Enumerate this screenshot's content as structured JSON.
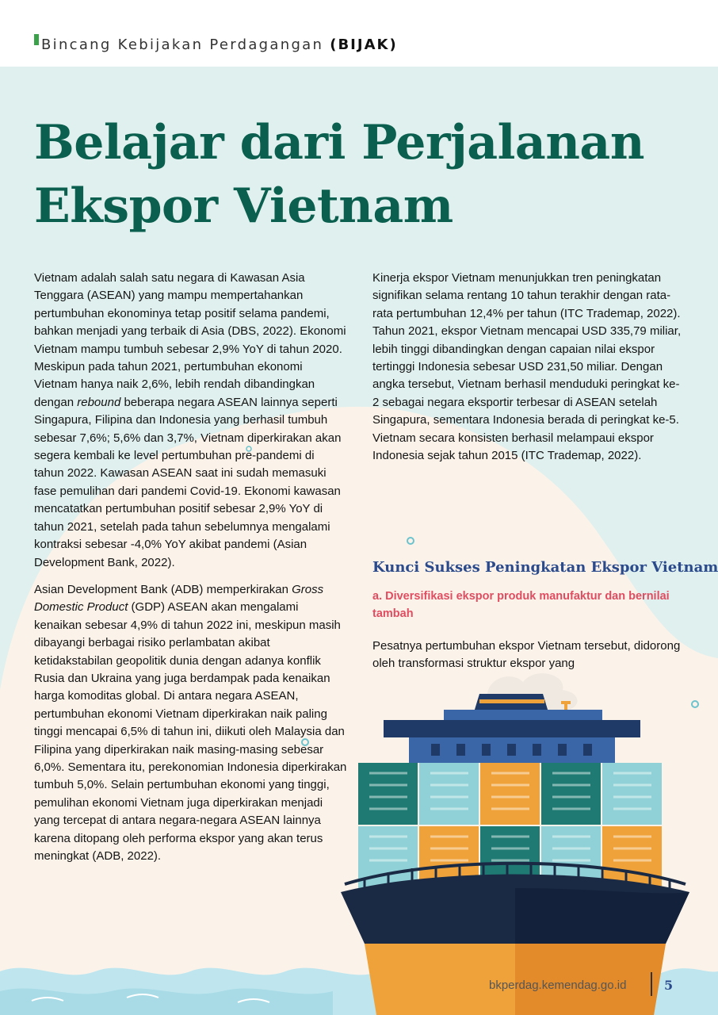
{
  "header": {
    "series_name": "Bincang Kebijakan Perdagangan",
    "series_abbr": "(BIJAK)"
  },
  "article": {
    "title_line1": "Belajar dari Perjalanan",
    "title_line2": "Ekspor Vietnam",
    "left_p1_a": "Vietnam adalah salah satu negara di Kawasan Asia Tenggara (ASEAN) yang mampu mempertahankan pertumbuhan ekonominya tetap positif selama pandemi, bahkan menjadi yang terbaik di Asia (DBS, 2022). Ekonomi Vietnam mampu tumbuh sebesar 2,9% YoY di tahun 2020. Meskipun pada tahun 2021, pertumbuhan ekonomi Vietnam hanya naik 2,6%, lebih rendah dibandingkan dengan ",
    "left_p1_em": "rebound",
    "left_p1_b": " beberapa negara ASEAN lainnya seperti Singapura, Filipina dan Indonesia yang berhasil tumbuh sebesar 7,6%; 5,6% dan 3,7%, Vietnam diperkirakan akan segera kembali ke level pertumbuhan pre-pandemi di tahun 2022.  Kawasan ASEAN saat ini sudah memasuki fase pemulihan dari pandemi Covid-19. Ekonomi kawasan mencatatkan pertumbuhan positif sebesar 2,9% YoY di tahun 2021, setelah pada tahun sebelumnya mengalami kontraksi sebesar -4,0% YoY akibat pandemi (Asian Development Bank, 2022).",
    "left_p2_a": "Asian Development Bank (ADB) memperkirakan ",
    "left_p2_em": "Gross Domestic Product",
    "left_p2_b": " (GDP) ASEAN akan mengalami kenaikan sebesar 4,9% di tahun 2022 ini, meskipun masih dibayangi berbagai risiko perlambatan akibat ketidakstabilan geopolitik dunia dengan adanya konflik Rusia dan Ukraina yang juga berdampak pada kenaikan harga komoditas global.  Di antara negara ASEAN, pertumbuhan ekonomi Vietnam diperkirakan naik paling tinggi mencapai 6,5% di tahun ini, diikuti oleh Malaysia dan Filipina yang diperkirakan naik masing-masing sebesar 6,0%. Sementara itu, perekonomian Indonesia diperkirakan tumbuh 5,0%. Selain pertumbuhan ekonomi yang tinggi, pemulihan ekonomi Vietnam juga diperkirakan menjadi yang tercepat di antara negara-negara ASEAN lainnya karena ditopang oleh performa ekspor yang akan terus meningkat (ADB, 2022).",
    "right_p1": "Kinerja ekspor Vietnam menunjukkan tren peningkatan signifikan selama rentang 10 tahun terakhir dengan rata-rata pertumbuhan 12,4% per tahun (ITC Trademap, 2022).  Tahun 2021, ekspor Vietnam mencapai USD 335,79 miliar, lebih tinggi dibandingkan dengan capaian nilai ekspor tertinggi Indonesia sebesar USD 231,50 miliar. Dengan angka tersebut, Vietnam berhasil menduduki peringkat ke-2 sebagai negara eksportir terbesar di ASEAN setelah Singapura, sementara Indonesia berada di peringkat ke-5. Vietnam secara konsisten berhasil melampaui ekspor Indonesia sejak tahun 2015 (ITC Trademap, 2022).",
    "section_heading": "Kunci Sukses Peningkatan Ekspor Vietnam",
    "subsection_heading": "a. Diversifikasi ekspor produk manufaktur dan bernilai tambah",
    "right_p2": "Pesatnya pertumbuhan ekspor Vietnam tersebut, didorong oleh  transformasi struktur ekspor yang"
  },
  "footer": {
    "url": "bkperdag.kemendag.go.id",
    "page_number": "5"
  },
  "colors": {
    "title": "#0b5f4e",
    "section_heading": "#2a4a8c",
    "subsection_heading": "#e04c60",
    "background_mint": "#dff0ee",
    "background_cream": "#fbf3ea",
    "water": "#bfe6ef"
  },
  "illustration": {
    "icon": "cargo-ship-icon"
  }
}
